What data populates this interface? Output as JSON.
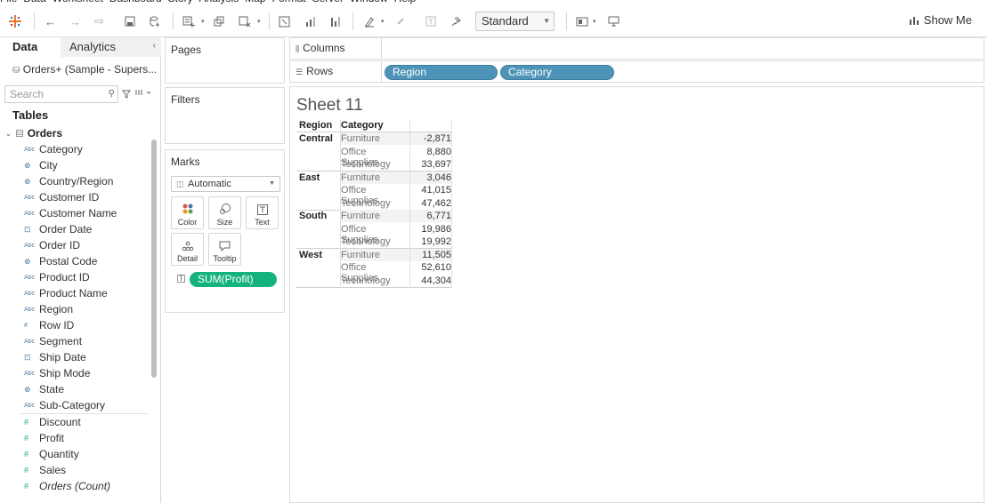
{
  "menu": [
    "File",
    "Data",
    "Worksheet",
    "Dashboard",
    "Story",
    "Analysis",
    "Map",
    "Format",
    "Server",
    "Window",
    "Help"
  ],
  "toolbar": {
    "fit_mode": "Standard",
    "show_me": "Show Me"
  },
  "datapane": {
    "tab_data": "Data",
    "tab_analytics": "Analytics",
    "datasource": "Orders+ (Sample - Supers...",
    "search_placeholder": "Search",
    "tables_title": "Tables",
    "table_name": "Orders",
    "dimensions": [
      {
        "label": "Category",
        "icon": "abc"
      },
      {
        "label": "City",
        "icon": "geo"
      },
      {
        "label": "Country/Region",
        "icon": "geo"
      },
      {
        "label": "Customer ID",
        "icon": "abc"
      },
      {
        "label": "Customer Name",
        "icon": "abc"
      },
      {
        "label": "Order Date",
        "icon": "cal"
      },
      {
        "label": "Order ID",
        "icon": "abc"
      },
      {
        "label": "Postal Code",
        "icon": "geo"
      },
      {
        "label": "Product ID",
        "icon": "abc"
      },
      {
        "label": "Product Name",
        "icon": "abc"
      },
      {
        "label": "Region",
        "icon": "abc"
      },
      {
        "label": "Row ID",
        "icon": "num"
      },
      {
        "label": "Segment",
        "icon": "abc"
      },
      {
        "label": "Ship Date",
        "icon": "cal"
      },
      {
        "label": "Ship Mode",
        "icon": "abc"
      },
      {
        "label": "State",
        "icon": "geo"
      },
      {
        "label": "Sub-Category",
        "icon": "abc"
      }
    ],
    "measures": [
      {
        "label": "Discount",
        "icon": "num"
      },
      {
        "label": "Profit",
        "icon": "num"
      },
      {
        "label": "Quantity",
        "icon": "num"
      },
      {
        "label": "Sales",
        "icon": "num"
      },
      {
        "label": "Orders (Count)",
        "icon": "num",
        "italic": true
      }
    ]
  },
  "cards": {
    "pages": "Pages",
    "filters": "Filters",
    "marks": "Marks",
    "mark_type": "Automatic",
    "mark_buttons": [
      "Color",
      "Size",
      "Text",
      "Detail",
      "Tooltip"
    ],
    "profit_pill": "SUM(Profit)"
  },
  "shelves": {
    "columns": "Columns",
    "rows": "Rows",
    "row_pills": [
      "Region",
      "Category"
    ]
  },
  "sheet": {
    "title": "Sheet 11",
    "header_region": "Region",
    "header_category": "Category",
    "groups": [
      {
        "region": "Central",
        "rows": [
          {
            "category": "Furniture",
            "value": "-2,871"
          },
          {
            "category": "Office Supplies",
            "value": "8,880"
          },
          {
            "category": "Technology",
            "value": "33,697"
          }
        ]
      },
      {
        "region": "East",
        "rows": [
          {
            "category": "Furniture",
            "value": "3,046"
          },
          {
            "category": "Office Supplies",
            "value": "41,015"
          },
          {
            "category": "Technology",
            "value": "47,462"
          }
        ]
      },
      {
        "region": "South",
        "rows": [
          {
            "category": "Furniture",
            "value": "6,771"
          },
          {
            "category": "Office Supplies",
            "value": "19,986"
          },
          {
            "category": "Technology",
            "value": "19,992"
          }
        ]
      },
      {
        "region": "West",
        "rows": [
          {
            "category": "Furniture",
            "value": "11,505"
          },
          {
            "category": "Office Supplies",
            "value": "52,610"
          },
          {
            "category": "Technology",
            "value": "44,304"
          }
        ]
      }
    ]
  }
}
